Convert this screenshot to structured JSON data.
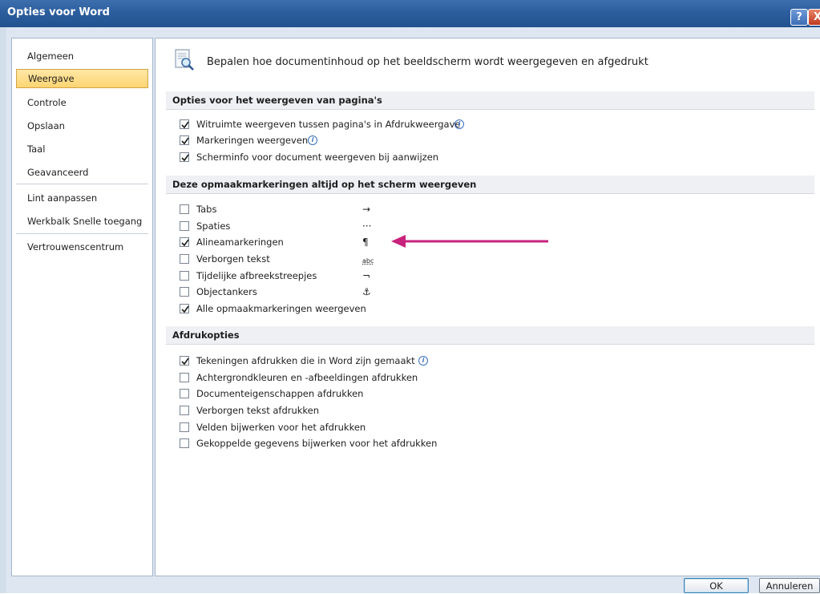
{
  "window": {
    "title": "Opties voor Word",
    "help_label": "?",
    "close_label": "X"
  },
  "sidebar": {
    "items": [
      {
        "label": "Algemeen",
        "active": false
      },
      {
        "label": "Weergave",
        "active": true
      },
      {
        "label": "Controle",
        "active": false
      },
      {
        "label": "Opslaan",
        "active": false
      },
      {
        "label": "Taal",
        "active": false
      },
      {
        "label": "Geavanceerd",
        "active": false
      },
      {
        "label": "Lint aanpassen",
        "active": false
      },
      {
        "label": "Werkbalk Snelle toegang",
        "active": false
      },
      {
        "label": "Vertrouwenscentrum",
        "active": false
      }
    ]
  },
  "header": {
    "text": "Bepalen hoe documentinhoud op het beeldscherm wordt weergegeven en afgedrukt",
    "icon": "document-magnifier-icon"
  },
  "sections": {
    "page_display": {
      "title": "Opties voor het weergeven van pagina's",
      "options": [
        {
          "label": "Witruimte weergeven tussen pagina's in Afdrukweergave",
          "checked": true,
          "info": true
        },
        {
          "label": "Markeringen weergeven",
          "checked": true,
          "info": true
        },
        {
          "label": "Scherminfo voor document weergeven bij aanwijzen",
          "checked": true,
          "info": false
        }
      ]
    },
    "formatting_marks": {
      "title": "Deze opmaakmarkeringen altijd op het scherm weergeven",
      "options": [
        {
          "label": "Tabs",
          "checked": false,
          "symbol": "→"
        },
        {
          "label": "Spaties",
          "checked": false,
          "symbol": "···"
        },
        {
          "label": "Alineamarkeringen",
          "checked": true,
          "symbol": "¶"
        },
        {
          "label": "Verborgen tekst",
          "checked": false,
          "symbol": "abc"
        },
        {
          "label": "Tijdelijke afbreekstreepjes",
          "checked": false,
          "symbol": "¬"
        },
        {
          "label": "Objectankers",
          "checked": false,
          "symbol": "⚓"
        },
        {
          "label": "Alle opmaakmarkeringen weergeven",
          "checked": true,
          "symbol": ""
        }
      ]
    },
    "print_options": {
      "title": "Afdrukopties",
      "options": [
        {
          "label": "Tekeningen afdrukken die in Word zijn gemaakt",
          "checked": true,
          "info": true
        },
        {
          "label": "Achtergrondkleuren en -afbeeldingen afdrukken",
          "checked": false,
          "info": false
        },
        {
          "label": "Documenteigenschappen afdrukken",
          "checked": false,
          "info": false
        },
        {
          "label": "Verborgen tekst afdrukken",
          "checked": false,
          "info": false
        },
        {
          "label": "Velden bijwerken voor het afdrukken",
          "checked": false,
          "info": false
        },
        {
          "label": "Gekoppelde gegevens bijwerken voor het afdrukken",
          "checked": false,
          "info": false
        }
      ]
    }
  },
  "annotation": {
    "type": "arrow",
    "color": "#c8237c",
    "points_to": "Alineamarkeringen"
  },
  "buttons": {
    "ok": "OK",
    "cancel": "Annuleren"
  },
  "colors": {
    "titlebar": "#2c5e9e",
    "active_nav": "#fdd572",
    "checkmark": "#1a1a1a"
  }
}
